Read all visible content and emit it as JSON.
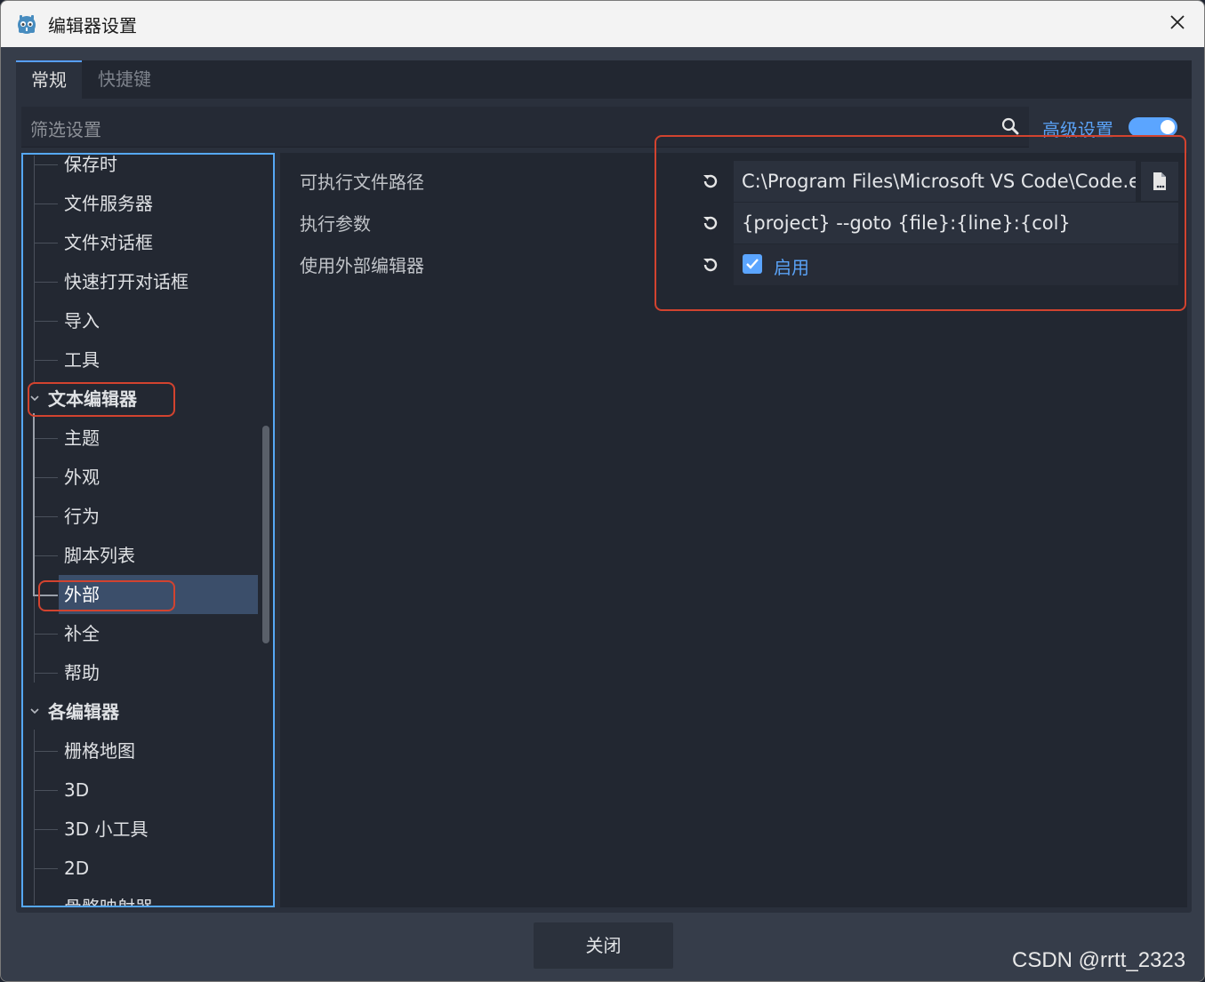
{
  "window": {
    "title": "编辑器设置"
  },
  "tabs": [
    {
      "label": "常规",
      "active": true
    },
    {
      "label": "快捷键",
      "active": false
    }
  ],
  "filter": {
    "placeholder": "筛选设置"
  },
  "advanced": {
    "label": "高级设置",
    "enabled": true
  },
  "tree": {
    "items": [
      {
        "label": "保存时"
      },
      {
        "label": "文件服务器"
      },
      {
        "label": "文件对话框"
      },
      {
        "label": "快速打开对话框"
      },
      {
        "label": "导入"
      },
      {
        "label": "工具"
      },
      {
        "label": "文本编辑器",
        "section": true,
        "expanded": true
      },
      {
        "label": "主题"
      },
      {
        "label": "外观"
      },
      {
        "label": "行为"
      },
      {
        "label": "脚本列表"
      },
      {
        "label": "外部",
        "selected": true
      },
      {
        "label": "补全"
      },
      {
        "label": "帮助"
      },
      {
        "label": "各编辑器",
        "section": true,
        "expanded": true
      },
      {
        "label": "栅格地图"
      },
      {
        "label": "3D"
      },
      {
        "label": "3D 小工具"
      },
      {
        "label": "2D"
      },
      {
        "label": "骨骼映射器"
      }
    ]
  },
  "properties": [
    {
      "label": "可执行文件路径",
      "value": "C:\\Program Files\\Microsoft VS Code\\Code.e"
    },
    {
      "label": "执行参数",
      "value": "{project} --goto {file}:{line}:{col}"
    },
    {
      "label": "使用外部编辑器",
      "checkbox_label": "启用",
      "checked": true
    }
  ],
  "footer": {
    "close_label": "关闭"
  },
  "watermark": "CSDN @rrtt_2323",
  "colors": {
    "accent": "#5ba5ff",
    "highlight": "#d2432f"
  }
}
